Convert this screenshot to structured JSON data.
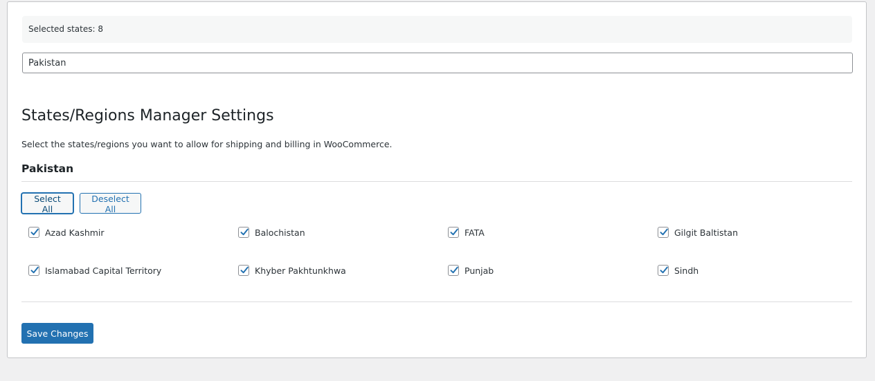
{
  "status": {
    "selected_label": "Selected states: 8"
  },
  "country_input": {
    "value": "Pakistan"
  },
  "settings": {
    "heading": "States/Regions Manager Settings",
    "description": "Select the states/regions you want to allow for shipping and billing in WooCommerce.",
    "country_title": "Pakistan"
  },
  "actions": {
    "select_all_label": "Select All",
    "deselect_all_label": "Deselect All",
    "save_label": "Save Changes"
  },
  "states": [
    {
      "label": "Azad Kashmir",
      "checked": true
    },
    {
      "label": "Balochistan",
      "checked": true
    },
    {
      "label": "FATA",
      "checked": true
    },
    {
      "label": "Gilgit Baltistan",
      "checked": true
    },
    {
      "label": "Islamabad Capital Territory",
      "checked": true
    },
    {
      "label": "Khyber Pakhtunkhwa",
      "checked": true
    },
    {
      "label": "Punjab",
      "checked": true
    },
    {
      "label": "Sindh",
      "checked": true
    }
  ],
  "colors": {
    "accent": "#2271b1",
    "checkmark": "#2271b1",
    "background": "#f0f0f1"
  },
  "icons": {
    "checkbox_checked": "checkmark-icon"
  }
}
